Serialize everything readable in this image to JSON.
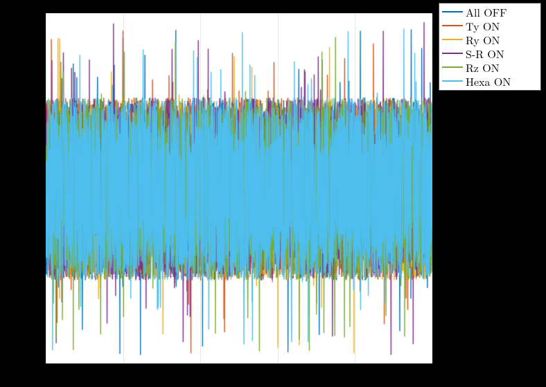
{
  "chart_data": {
    "type": "line",
    "title": "",
    "xlabel": "",
    "ylabel": "",
    "xlim": [
      0,
      1
    ],
    "ylim": [
      -1,
      1
    ],
    "grid_v_ticks": [
      0.0,
      0.2,
      0.4,
      0.6,
      0.8,
      1.0
    ],
    "grid_h_ticks": [
      -1.0,
      -0.5,
      0.0,
      0.5,
      1.0
    ],
    "signal": {
      "samples": 2000,
      "amplitude_core": 0.52,
      "amplitude_spike": 0.95
    },
    "series": [
      {
        "name": "All OFF",
        "color": "#0072BD"
      },
      {
        "name": "Ty ON",
        "color": "#D95319"
      },
      {
        "name": "Ry ON",
        "color": "#EDB120"
      },
      {
        "name": "S-R ON",
        "color": "#7E2F8E"
      },
      {
        "name": "Rz ON",
        "color": "#77AC30"
      },
      {
        "name": "Hexa ON",
        "color": "#4DBEEE"
      }
    ]
  }
}
